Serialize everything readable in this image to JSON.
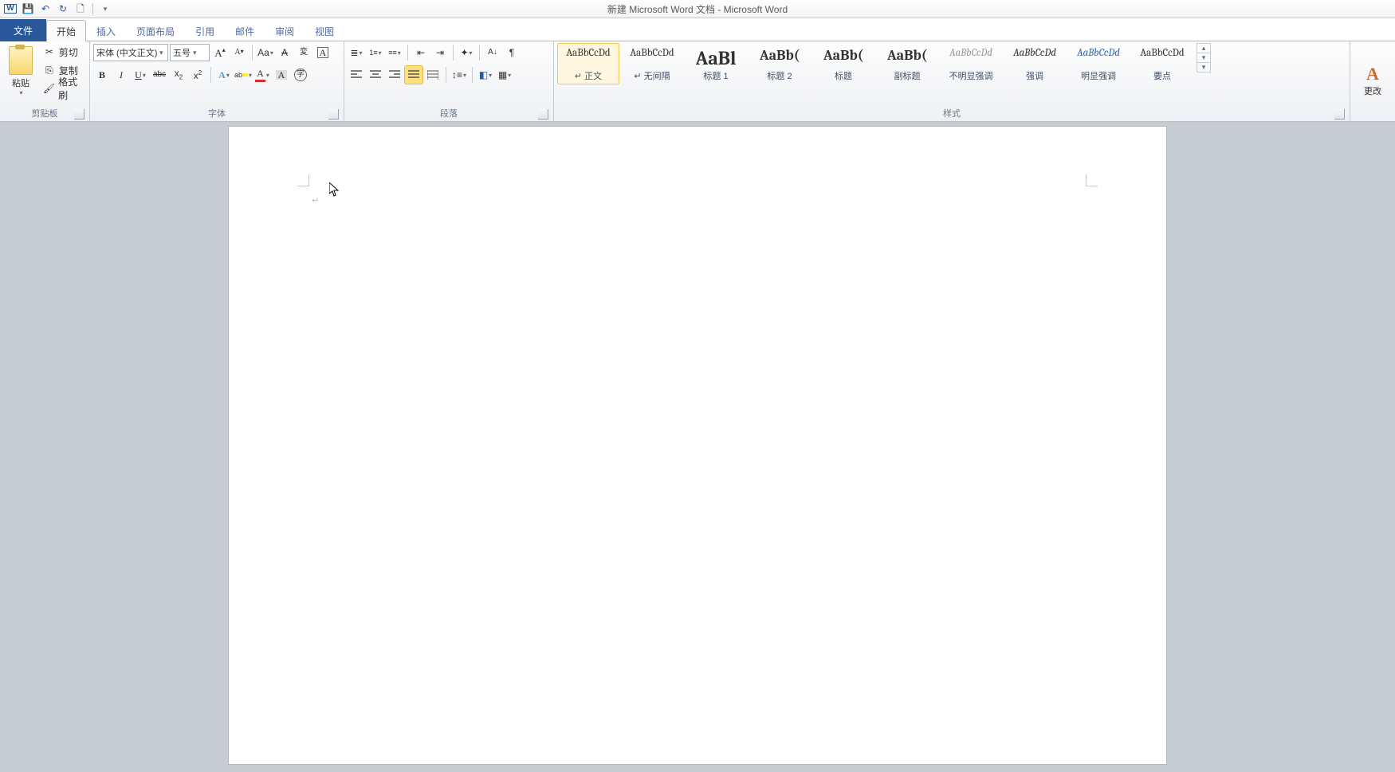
{
  "window": {
    "title": "新建 Microsoft Word 文档 - Microsoft Word"
  },
  "qat": {
    "items": [
      {
        "name": "app-icon",
        "glyph": "W"
      },
      {
        "name": "save",
        "glyph": "💾"
      },
      {
        "name": "undo",
        "glyph": "↶"
      },
      {
        "name": "redo",
        "glyph": "↻"
      },
      {
        "name": "new-doc",
        "glyph": "🗋"
      }
    ],
    "customize_glyph": "▾"
  },
  "tabs": {
    "file": "文件",
    "items": [
      "开始",
      "插入",
      "页面布局",
      "引用",
      "邮件",
      "审阅",
      "视图"
    ],
    "active_index": 0
  },
  "clipboard": {
    "paste_label": "粘贴",
    "cut": "剪切",
    "copy": "复制",
    "format_painter": "格式刷",
    "group_label": "剪贴板"
  },
  "font": {
    "name": "宋体 (中文正文)",
    "size": "五号",
    "grow": "A▴",
    "shrink": "A▾",
    "case_glyph": "Aa",
    "clear_glyph": "A̶",
    "phonetic_glyph": "拼",
    "charborder_glyph": "A□",
    "bold": "B",
    "italic": "I",
    "underline": "U",
    "strike": "abc",
    "sub": "x₂",
    "sup": "x²",
    "texteffects": "A",
    "highlight": "ab",
    "fontcolor": "A",
    "charshade": "A",
    "enclose": "㊕",
    "group_label": "字体"
  },
  "paragraph": {
    "group_label": "段落",
    "align_left": "≡",
    "align_center": "≡",
    "align_right": "≡",
    "justify": "≡",
    "distribute": "≡",
    "linespacing": "↕",
    "shading_glyph": "▦",
    "border_glyph": "□",
    "bullets": "•",
    "numbering": "1.",
    "multilevel": "⦿",
    "dec_indent": "⇤",
    "inc_indent": "⇥",
    "asian_glyph": "✧",
    "sort": "A↓",
    "showmarks": "¶"
  },
  "styles": {
    "group_label": "样式",
    "items": [
      {
        "preview": "AaBbCcDd",
        "name": "正文",
        "cls": ""
      },
      {
        "preview": "AaBbCcDd",
        "name": "无间隔",
        "cls": ""
      },
      {
        "preview": "AaBl",
        "name": "标题 1",
        "cls": "big"
      },
      {
        "preview": "AaBb(",
        "name": "标题 2",
        "cls": "mid"
      },
      {
        "preview": "AaBb(",
        "name": "标题",
        "cls": "mid"
      },
      {
        "preview": "AaBb(",
        "name": "副标题",
        "cls": "mid"
      },
      {
        "preview": "AaBbCcDd",
        "name": "不明显强调",
        "cls": "ital gray"
      },
      {
        "preview": "AaBbCcDd",
        "name": "强调",
        "cls": "ital"
      },
      {
        "preview": "AaBbCcDd",
        "name": "明显强调",
        "cls": "ital blue"
      },
      {
        "preview": "AaBbCcDd",
        "name": "要点",
        "cls": ""
      }
    ],
    "selected_index": 0
  },
  "changestyles": {
    "label": "更改"
  },
  "cursor_mark": "↵"
}
